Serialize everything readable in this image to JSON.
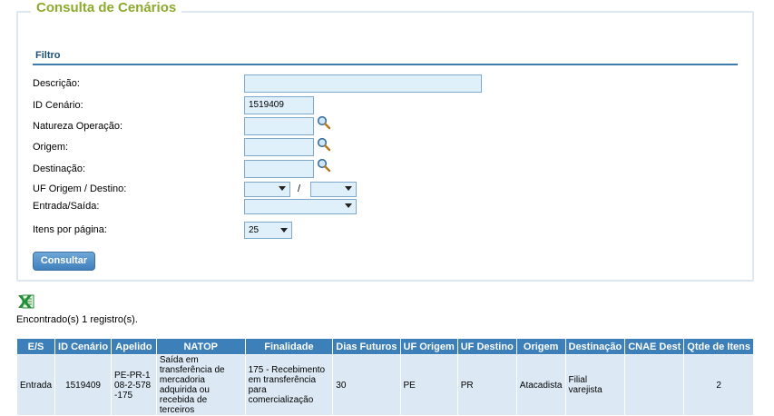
{
  "page": {
    "legend": "Consulta de Cenários",
    "filter_title": "Filtro"
  },
  "form": {
    "descricao_label": "Descrição:",
    "descricao_value": "",
    "id_cenario_label": "ID Cenário:",
    "id_cenario_value": "1519409",
    "natureza_label": "Natureza Operação:",
    "natureza_value": "",
    "origem_label": "Origem:",
    "origem_value": "",
    "destinacao_label": "Destinação:",
    "destinacao_value": "",
    "uf_label": "UF Origem / Destino:",
    "uf_origem_value": "",
    "uf_separator": "/",
    "uf_destino_value": "",
    "entrada_saida_label": "Entrada/Saída:",
    "entrada_saida_value": "",
    "itens_label": "Itens por página:",
    "itens_value": "25",
    "submit_label": "Consultar"
  },
  "results": {
    "export_icon": "excel-icon",
    "found_text": "Encontrado(s) 1 registro(s).",
    "headers": [
      "E/S",
      "ID Cenário",
      "Apelido",
      "NATOP",
      "Finalidade",
      "Dias Futuros",
      "UF Origem",
      "UF Destino",
      "Origem",
      "Destinação",
      "CNAE Dest",
      "Qtde de Itens"
    ],
    "rows": [
      [
        "Entrada",
        "1519409",
        "PE-PR-108-2-578-175",
        "Saída em transferência de mercadoria adquirida ou recebida de terceiros",
        "175 - Recebimento em transferência para comercialização",
        "30",
        "PE",
        "PR",
        "Atacadista",
        "Filial varejista",
        "",
        "2"
      ]
    ]
  },
  "colors": {
    "legend": "#8caa2c",
    "header_bg": "#3c7fb9",
    "input_bg": "#dff0fb",
    "row_bg": "#dce9f4"
  }
}
